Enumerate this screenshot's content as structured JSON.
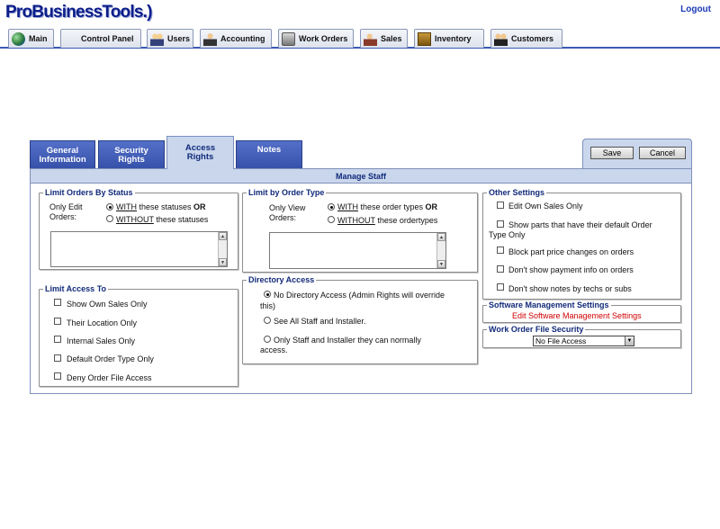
{
  "header": {
    "logo": "ProBusinessTools.",
    "logo_mark": ")",
    "logout": "Logout"
  },
  "nav": [
    {
      "label": "Main",
      "icon": "globe-icon"
    },
    {
      "label": "Control Panel",
      "icon": "control-panel-icon"
    },
    {
      "label": "Users",
      "icon": "users-icon"
    },
    {
      "label": "Accounting",
      "icon": "accounting-icon"
    },
    {
      "label": "Work Orders",
      "icon": "work-orders-icon"
    },
    {
      "label": "Sales",
      "icon": "sales-icon"
    },
    {
      "label": "Inventory",
      "icon": "inventory-icon"
    },
    {
      "label": "Customers",
      "icon": "customers-icon"
    }
  ],
  "tabs": [
    {
      "line1": "General",
      "line2": "Information"
    },
    {
      "line1": "Security",
      "line2": "Rights"
    },
    {
      "line1": "Access",
      "line2": "Rights"
    },
    {
      "line1": "Notes",
      "line2": ""
    }
  ],
  "buttons": {
    "save": "Save",
    "cancel": "Cancel"
  },
  "manage_staff": "Manage Staff",
  "limit_status": {
    "legend": "Limit Orders By Status",
    "label1": "Only Edit",
    "label2": "Orders:",
    "with_u": "WITH",
    "with_rest": " these statuses ",
    "or": "OR",
    "without_u": "WITHOUT",
    "without_rest": " these statuses"
  },
  "limit_type": {
    "legend": "Limit by Order Type",
    "label1": "Only View",
    "label2": "Orders:",
    "with_u": "WITH",
    "with_rest": " these order types ",
    "or": "OR",
    "without_u": "WITHOUT",
    "without_rest": " these ordertypes"
  },
  "other": {
    "legend": "Other Settings",
    "items": [
      "Edit Own Sales Only",
      "Show parts that have their default Order",
      "Type Only",
      "Block part price changes on orders",
      "Don't show payment info on orders",
      "Don't show notes by techs or subs"
    ]
  },
  "access_to": {
    "legend": "Limit Access To",
    "items": [
      "Show Own Sales Only",
      "Their Location Only",
      "Internal Sales Only",
      "Default Order Type Only",
      "Deny Order File Access"
    ]
  },
  "directory": {
    "legend": "Directory Access",
    "opt1a": "No Directory Access (Admin Rights will override",
    "opt1b": "this)",
    "opt2": "See All Staff and Installer.",
    "opt3a": "Only Staff and Installer they can normally",
    "opt3b": "access."
  },
  "software": {
    "legend": "Software Management Settings",
    "link": "Edit Software Management Settings"
  },
  "wofile": {
    "legend": "Work Order File Security",
    "selected": "No File Access"
  }
}
